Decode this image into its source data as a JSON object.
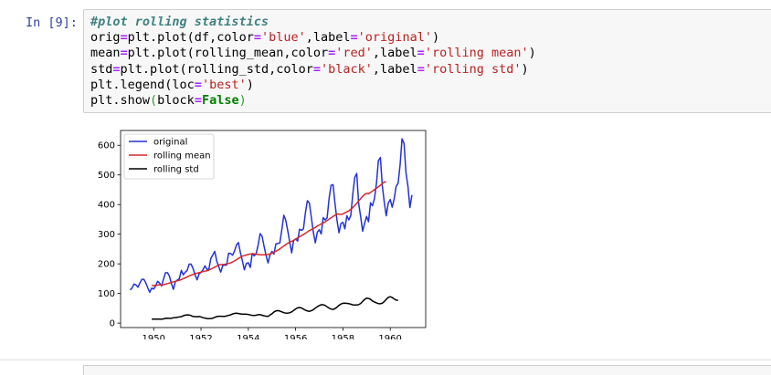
{
  "cell": {
    "prompt": "In [9]:",
    "code_lines": [
      "#plot rolling statistics",
      "orig=plt.plot(df,color='blue',label='original')",
      "mean=plt.plot(rolling_mean,color='red',label='rolling mean')",
      "std=plt.plot(rolling_std,color='black',label='rolling std')",
      "plt.legend(loc='best')",
      "plt.show(block=False)"
    ]
  },
  "chart_data": {
    "type": "line",
    "title": "",
    "xlabel": "",
    "ylabel": "",
    "xlim": [
      1948.6,
      1961.5
    ],
    "ylim": [
      -15,
      650
    ],
    "x_ticks": [
      "1950",
      "1952",
      "1954",
      "1956",
      "1958",
      "1960"
    ],
    "y_ticks": [
      "0",
      "100",
      "200",
      "300",
      "400",
      "500",
      "600"
    ],
    "grid": false,
    "legend_position": "upper left",
    "series": [
      {
        "name": "original",
        "color": "#2332d6",
        "x_start": "1949-01",
        "frequency": "monthly",
        "values": [
          112,
          118,
          132,
          129,
          121,
          135,
          148,
          148,
          136,
          119,
          104,
          118,
          115,
          126,
          141,
          135,
          125,
          149,
          170,
          170,
          158,
          133,
          114,
          140,
          145,
          150,
          178,
          163,
          172,
          178,
          199,
          199,
          184,
          162,
          146,
          166,
          171,
          180,
          193,
          181,
          183,
          218,
          230,
          242,
          209,
          191,
          172,
          194,
          196,
          196,
          236,
          235,
          229,
          243,
          264,
          272,
          237,
          211,
          180,
          201,
          204,
          188,
          235,
          227,
          234,
          264,
          302,
          293,
          259,
          229,
          203,
          229,
          242,
          233,
          267,
          269,
          270,
          315,
          364,
          347,
          312,
          274,
          237,
          278,
          284,
          277,
          317,
          313,
          318,
          374,
          413,
          405,
          355,
          306,
          271,
          306,
          315,
          301,
          356,
          348,
          355,
          422,
          465,
          467,
          404,
          347,
          305,
          336,
          340,
          318,
          362,
          348,
          363,
          435,
          491,
          505,
          404,
          359,
          310,
          337,
          360,
          342,
          406,
          396,
          420,
          472,
          548,
          559,
          463,
          407,
          362,
          405,
          417,
          391,
          419,
          461,
          472,
          535,
          622,
          606,
          508,
          461,
          390,
          432
        ]
      },
      {
        "name": "rolling mean",
        "color": "#d62728",
        "x_start": "1949-12",
        "frequency": "monthly",
        "window": 12,
        "values": [
          126.7,
          126.9,
          127.6,
          128.3,
          128.8,
          129.0,
          129.8,
          131.5,
          133.4,
          135.3,
          137.0,
          139.3,
          140.9,
          142.8,
          144.9,
          146.8,
          150.1,
          152.8,
          156.1,
          159.2,
          161.8,
          164.4,
          166.9,
          168.4,
          170.2,
          172.3,
          174.1,
          175.3,
          176.6,
          178.9,
          182.0,
          185.3,
          188.8,
          192.5,
          196.8,
          197.3,
          197.7,
          198.3,
          199.8,
          201.3,
          203.0,
          206.3,
          210.2,
          214.1,
          218.1,
          222.3,
          226.2,
          227.6,
          229.8,
          231.9,
          232.8,
          233.5,
          233.4,
          232.4,
          231.5,
          230.8,
          230.6,
          230.4,
          230.6,
          231.7,
          233.2,
          236.5,
          239.2,
          242.8,
          246.3,
          250.3,
          255.2,
          260.2,
          264.8,
          269.1,
          273.3,
          276.2,
          279.4,
          283.5,
          287.7,
          291.3,
          295.1,
          299.0,
          302.9,
          307.8,
          312.2,
          315.8,
          318.8,
          322.9,
          327.3,
          330.9,
          334.8,
          338.2,
          341.4,
          346.1,
          350.8,
          355.1,
          359.9,
          363.8,
          368.4,
          367.8,
          366.8,
          368.3,
          372.0,
          375.4,
          378.6,
          384.2,
          389.9,
          396.8,
          404.1,
          412.4,
          420.2,
          427.0,
          434.2,
          437.6,
          436.3,
          441.4,
          445.0,
          450.4,
          454.9,
          460.1,
          464.9,
          470.7,
          475.9,
          476.2
        ]
      },
      {
        "name": "rolling std",
        "color": "#000000",
        "x_start": "1949-12",
        "frequency": "monthly",
        "window": 12,
        "values": [
          13.7,
          13.4,
          13.2,
          13.7,
          13.3,
          13.1,
          14.2,
          16.0,
          16.6,
          16.0,
          16.2,
          18.1,
          18.5,
          19.4,
          21.1,
          21.7,
          24.6,
          26.9,
          27.9,
          27.5,
          25.3,
          22.3,
          21.8,
          21.0,
          22.2,
          21.1,
          18.2,
          17.0,
          15.6,
          14.9,
          15.5,
          16.8,
          19.5,
          21.8,
          23.3,
          23.3,
          22.9,
          22.9,
          24.0,
          26.0,
          27.7,
          30.9,
          32.8,
          33.3,
          32.4,
          31.3,
          30.0,
          30.2,
          30.1,
          29.2,
          27.5,
          26.4,
          26.1,
          26.7,
          28.5,
          28.5,
          26.7,
          24.6,
          23.6,
          22.7,
          27.1,
          31.6,
          37.5,
          40.9,
          42.3,
          40.6,
          37.8,
          35.2,
          33.9,
          33.7,
          34.8,
          38.1,
          42.5,
          47.9,
          51.5,
          52.4,
          51.3,
          47.3,
          43.5,
          41.1,
          39.9,
          42.0,
          45.3,
          50.6,
          55.1,
          59.2,
          61.9,
          62.0,
          59.5,
          55.0,
          50.3,
          47.5,
          45.9,
          48.9,
          53.8,
          60.0,
          64.5,
          67.0,
          67.1,
          66.5,
          65.7,
          63.8,
          61.7,
          61.4,
          61.0,
          62.4,
          66.2,
          72.9,
          79.9,
          84.0,
          83.3,
          80.3,
          75.0,
          71.1,
          68.5,
          66.1,
          65.5,
          67.3,
          73.1,
          80.2,
          86.5,
          89.2,
          86.3,
          81.8,
          77.6,
          76.8
        ]
      }
    ]
  }
}
